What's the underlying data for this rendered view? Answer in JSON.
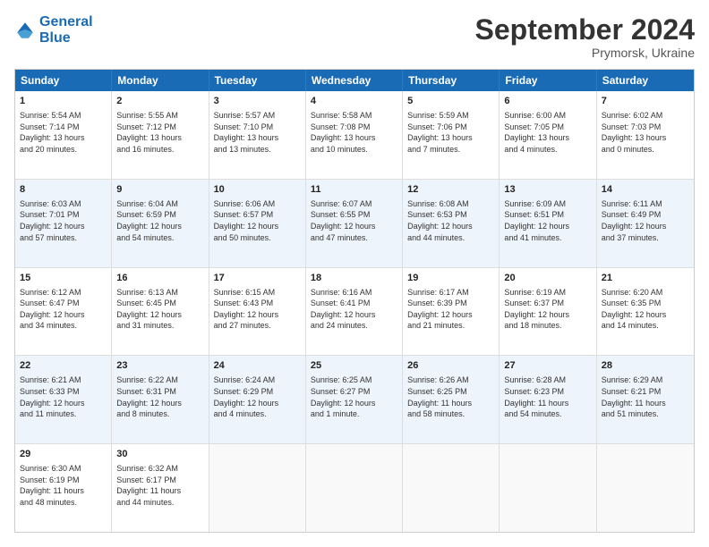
{
  "header": {
    "logo_line1": "General",
    "logo_line2": "Blue",
    "month": "September 2024",
    "location": "Prymorsk, Ukraine"
  },
  "days_of_week": [
    "Sunday",
    "Monday",
    "Tuesday",
    "Wednesday",
    "Thursday",
    "Friday",
    "Saturday"
  ],
  "rows": [
    {
      "alt": false,
      "cells": [
        {
          "day": "1",
          "text": "Sunrise: 5:54 AM\nSunset: 7:14 PM\nDaylight: 13 hours\nand 20 minutes."
        },
        {
          "day": "2",
          "text": "Sunrise: 5:55 AM\nSunset: 7:12 PM\nDaylight: 13 hours\nand 16 minutes."
        },
        {
          "day": "3",
          "text": "Sunrise: 5:57 AM\nSunset: 7:10 PM\nDaylight: 13 hours\nand 13 minutes."
        },
        {
          "day": "4",
          "text": "Sunrise: 5:58 AM\nSunset: 7:08 PM\nDaylight: 13 hours\nand 10 minutes."
        },
        {
          "day": "5",
          "text": "Sunrise: 5:59 AM\nSunset: 7:06 PM\nDaylight: 13 hours\nand 7 minutes."
        },
        {
          "day": "6",
          "text": "Sunrise: 6:00 AM\nSunset: 7:05 PM\nDaylight: 13 hours\nand 4 minutes."
        },
        {
          "day": "7",
          "text": "Sunrise: 6:02 AM\nSunset: 7:03 PM\nDaylight: 13 hours\nand 0 minutes."
        }
      ]
    },
    {
      "alt": true,
      "cells": [
        {
          "day": "8",
          "text": "Sunrise: 6:03 AM\nSunset: 7:01 PM\nDaylight: 12 hours\nand 57 minutes."
        },
        {
          "day": "9",
          "text": "Sunrise: 6:04 AM\nSunset: 6:59 PM\nDaylight: 12 hours\nand 54 minutes."
        },
        {
          "day": "10",
          "text": "Sunrise: 6:06 AM\nSunset: 6:57 PM\nDaylight: 12 hours\nand 50 minutes."
        },
        {
          "day": "11",
          "text": "Sunrise: 6:07 AM\nSunset: 6:55 PM\nDaylight: 12 hours\nand 47 minutes."
        },
        {
          "day": "12",
          "text": "Sunrise: 6:08 AM\nSunset: 6:53 PM\nDaylight: 12 hours\nand 44 minutes."
        },
        {
          "day": "13",
          "text": "Sunrise: 6:09 AM\nSunset: 6:51 PM\nDaylight: 12 hours\nand 41 minutes."
        },
        {
          "day": "14",
          "text": "Sunrise: 6:11 AM\nSunset: 6:49 PM\nDaylight: 12 hours\nand 37 minutes."
        }
      ]
    },
    {
      "alt": false,
      "cells": [
        {
          "day": "15",
          "text": "Sunrise: 6:12 AM\nSunset: 6:47 PM\nDaylight: 12 hours\nand 34 minutes."
        },
        {
          "day": "16",
          "text": "Sunrise: 6:13 AM\nSunset: 6:45 PM\nDaylight: 12 hours\nand 31 minutes."
        },
        {
          "day": "17",
          "text": "Sunrise: 6:15 AM\nSunset: 6:43 PM\nDaylight: 12 hours\nand 27 minutes."
        },
        {
          "day": "18",
          "text": "Sunrise: 6:16 AM\nSunset: 6:41 PM\nDaylight: 12 hours\nand 24 minutes."
        },
        {
          "day": "19",
          "text": "Sunrise: 6:17 AM\nSunset: 6:39 PM\nDaylight: 12 hours\nand 21 minutes."
        },
        {
          "day": "20",
          "text": "Sunrise: 6:19 AM\nSunset: 6:37 PM\nDaylight: 12 hours\nand 18 minutes."
        },
        {
          "day": "21",
          "text": "Sunrise: 6:20 AM\nSunset: 6:35 PM\nDaylight: 12 hours\nand 14 minutes."
        }
      ]
    },
    {
      "alt": true,
      "cells": [
        {
          "day": "22",
          "text": "Sunrise: 6:21 AM\nSunset: 6:33 PM\nDaylight: 12 hours\nand 11 minutes."
        },
        {
          "day": "23",
          "text": "Sunrise: 6:22 AM\nSunset: 6:31 PM\nDaylight: 12 hours\nand 8 minutes."
        },
        {
          "day": "24",
          "text": "Sunrise: 6:24 AM\nSunset: 6:29 PM\nDaylight: 12 hours\nand 4 minutes."
        },
        {
          "day": "25",
          "text": "Sunrise: 6:25 AM\nSunset: 6:27 PM\nDaylight: 12 hours\nand 1 minute."
        },
        {
          "day": "26",
          "text": "Sunrise: 6:26 AM\nSunset: 6:25 PM\nDaylight: 11 hours\nand 58 minutes."
        },
        {
          "day": "27",
          "text": "Sunrise: 6:28 AM\nSunset: 6:23 PM\nDaylight: 11 hours\nand 54 minutes."
        },
        {
          "day": "28",
          "text": "Sunrise: 6:29 AM\nSunset: 6:21 PM\nDaylight: 11 hours\nand 51 minutes."
        }
      ]
    },
    {
      "alt": false,
      "cells": [
        {
          "day": "29",
          "text": "Sunrise: 6:30 AM\nSunset: 6:19 PM\nDaylight: 11 hours\nand 48 minutes."
        },
        {
          "day": "30",
          "text": "Sunrise: 6:32 AM\nSunset: 6:17 PM\nDaylight: 11 hours\nand 44 minutes."
        },
        {
          "day": "",
          "text": ""
        },
        {
          "day": "",
          "text": ""
        },
        {
          "day": "",
          "text": ""
        },
        {
          "day": "",
          "text": ""
        },
        {
          "day": "",
          "text": ""
        }
      ]
    }
  ]
}
